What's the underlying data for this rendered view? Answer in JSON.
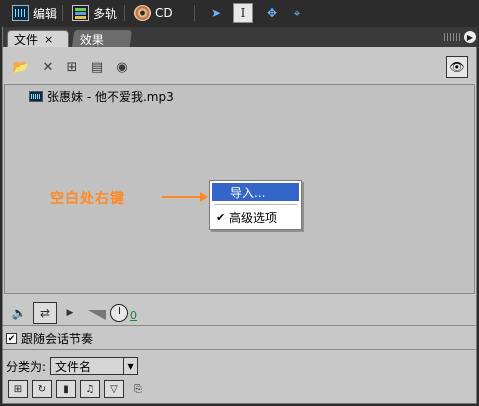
{
  "topbar": {
    "modes": [
      {
        "label": "编辑",
        "icon": "waveform-edit-icon"
      },
      {
        "label": "多轨",
        "icon": "multitrack-icon"
      },
      {
        "label": "CD",
        "icon": "cd-icon"
      }
    ],
    "tools": [
      "move-tool-icon",
      "time-selection-tool-icon",
      "marquee-tool-icon",
      "lasso-tool-icon"
    ]
  },
  "panel": {
    "tabs": [
      {
        "label": "文件",
        "close": "×",
        "active": true
      },
      {
        "label": "效果",
        "active": false
      }
    ],
    "menu_glyph": "▶"
  },
  "files": [
    {
      "name": "张惠妹 - 他不爱我.mp3",
      "icon": "waveform-file-icon"
    }
  ],
  "annotation": {
    "text": "空白处右键",
    "color": "#ff8a24"
  },
  "context_menu": {
    "items": [
      {
        "label": "导入...",
        "highlighted": true
      },
      {
        "label": "高级选项",
        "checked": true
      }
    ]
  },
  "playback": {
    "level_value": "0"
  },
  "follow_session": {
    "label": "跟随会话节奏",
    "checked": true
  },
  "sort": {
    "label": "分类为:",
    "selected": "文件名"
  },
  "colors": {
    "highlight": "#3465c8",
    "panel_bg": "#c8c8c8",
    "dark_bg": "#2c2c2c"
  }
}
